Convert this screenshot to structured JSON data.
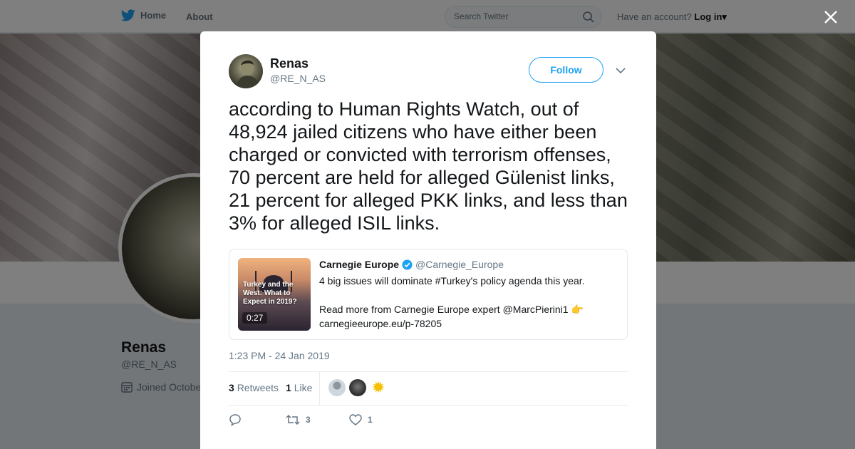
{
  "background_page": {
    "nav": {
      "home": "Home",
      "about": "About"
    },
    "search": {
      "placeholder": "Search Twitter"
    },
    "account": {
      "prompt": "Have an account?",
      "login": "Log in"
    },
    "profile": {
      "name": "Renas",
      "handle": "@RE_N_AS",
      "joined": "Joined Octobe"
    }
  },
  "tweet": {
    "author": {
      "name": "Renas",
      "handle": "@RE_N_AS"
    },
    "follow_label": "Follow",
    "text": "according to Human Rights Watch, out of 48,924 jailed citizens who have either been charged or convicted with terrorism offenses, 70 percent are held for alleged Gülenist links, 21 percent for alleged PKK links, and less than 3% for alleged ISIL links.",
    "quoted": {
      "name": "Carnegie Europe",
      "handle": "@Carnegie_Europe",
      "verified": true,
      "line1": "4 big issues will dominate #Turkey's policy agenda this year.",
      "line2": "Read more from Carnegie Europe expert @MarcPierini1 👉",
      "line3": "carnegieeurope.eu/p-78205",
      "thumbnail_title": "Turkey and the West: What to Expect in 2019?",
      "video_duration": "0:27"
    },
    "timestamp": "1:23 PM - 24 Jan 2019",
    "stats": {
      "retweets_count": "3",
      "retweets_label": "Retweets",
      "likes_count": "1",
      "likes_label": "Like"
    },
    "actions": {
      "retweet_count": "3",
      "like_count": "1"
    }
  },
  "colors": {
    "accent": "#1da1f2",
    "text": "#14171a",
    "muted": "#657786",
    "border": "#e6ecf0"
  }
}
